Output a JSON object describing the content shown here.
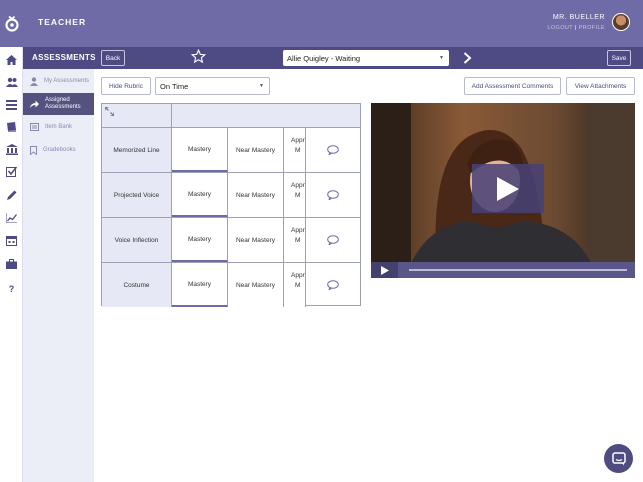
{
  "header": {
    "role": "TEACHER",
    "user_name": "MR. BUELLER",
    "logout": "LOGOUT",
    "profile": "PROFILE"
  },
  "subbar": {
    "title": "ASSESSMENTS",
    "back": "Back",
    "student": "Allie Quigley - Waiting",
    "save": "Save"
  },
  "sidebar": {
    "items": [
      {
        "label": "My Assessments",
        "icon": "user-icon"
      },
      {
        "label": "Assigned Assessments",
        "icon": "share-arrow-icon"
      },
      {
        "label": "Item Bank",
        "icon": "list-box-icon"
      },
      {
        "label": "Gradebooks",
        "icon": "bookmark-icon"
      }
    ]
  },
  "toolbar": {
    "hide_rubric": "Hide Rubric",
    "status": "On Time",
    "add_comments": "Add Assessment Comments",
    "view_attachments": "View Attachments"
  },
  "rubric": {
    "rows": [
      {
        "criterion": "Memorized Line",
        "level1": "Mastery",
        "level2": "Near Mastery",
        "level3a": "Appr",
        "level3b": "M"
      },
      {
        "criterion": "Projected Voice",
        "level1": "Mastery",
        "level2": "Near Mastery",
        "level3a": "Appr",
        "level3b": "M"
      },
      {
        "criterion": "Voice Inflection",
        "level1": "Mastery",
        "level2": "Near Mastery",
        "level3a": "Appr",
        "level3b": "M"
      },
      {
        "criterion": "Costume",
        "level1": "Mastery",
        "level2": "Near Mastery",
        "level3a": "Appr",
        "level3b": "M"
      }
    ]
  },
  "colors": {
    "topbar": "#6e6ba7",
    "subbar": "#4d4a84",
    "accent": "#4f4c80"
  }
}
